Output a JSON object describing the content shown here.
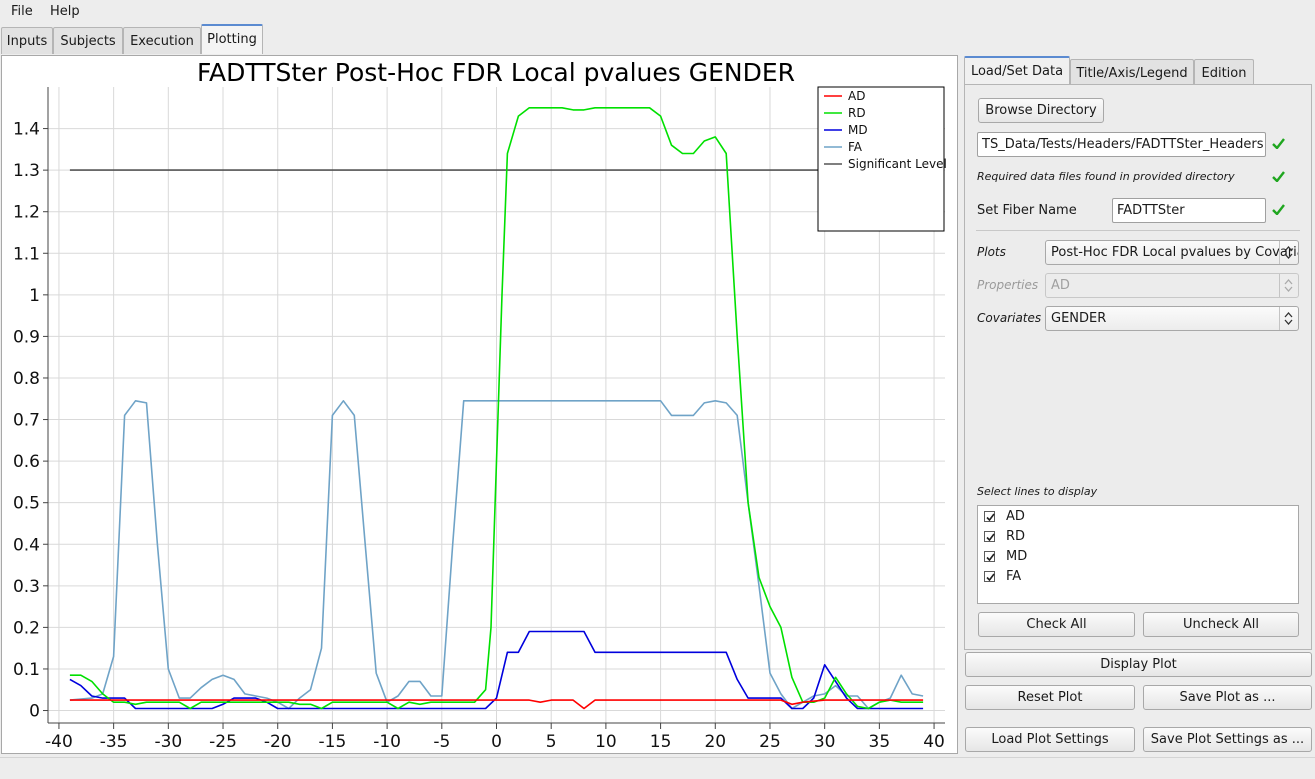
{
  "menu": {
    "file": "File",
    "help": "Help"
  },
  "main_tabs": [
    "Inputs",
    "Subjects",
    "Execution",
    "Plotting"
  ],
  "right_tabs": [
    "Load/Set Data",
    "Title/Axis/Legend",
    "Edition"
  ],
  "browse_label": "Browse Directory",
  "directory_path": "TS_Data/Tests/Headers/FADTTSter_Headers",
  "data_found_text": "Required data files found in provided directory",
  "fiber_name_label": "Set Fiber Name",
  "fiber_name_value": "FADTTSter",
  "plots_label": "Plots",
  "plots_value": "Post-Hoc FDR Local pvalues by Covariates",
  "properties_label": "Properties",
  "properties_value": "AD",
  "covariates_label": "Covariates",
  "covariates_value": "GENDER",
  "select_lines_label": "Select lines to display",
  "lines": [
    {
      "label": "AD",
      "checked": true
    },
    {
      "label": "RD",
      "checked": true
    },
    {
      "label": "MD",
      "checked": true
    },
    {
      "label": "FA",
      "checked": true
    }
  ],
  "check_all": "Check All",
  "uncheck_all": "Uncheck All",
  "display_plot": "Display Plot",
  "reset_plot": "Reset Plot",
  "save_plot_as": "Save Plot as ...",
  "load_plot_settings": "Load Plot Settings",
  "save_plot_settings_as": "Save Plot Settings as ...",
  "chart_data": {
    "type": "line",
    "title": "FADTTSter Post-Hoc FDR Local pvalues GENDER",
    "xlabel": "",
    "ylabel": "",
    "xlim": [
      -41,
      41
    ],
    "ylim": [
      -0.03,
      1.5
    ],
    "xticks": [
      -40,
      -35,
      -30,
      -25,
      -20,
      -15,
      -10,
      -5,
      0,
      5,
      10,
      15,
      20,
      25,
      30,
      35,
      40
    ],
    "yticks": [
      0,
      0.1,
      0.2,
      0.3,
      0.4,
      0.5,
      0.6,
      0.7,
      0.8,
      0.9,
      1,
      1.1,
      1.2,
      1.3,
      1.4
    ],
    "ytick_labels": [
      "0",
      "0.1",
      "0.2",
      "0.3",
      "0.4",
      "0.5",
      "0.6",
      "0.7",
      "0.8",
      "0.9",
      "1",
      "1.1",
      "1.2",
      "1.3",
      "1.4"
    ],
    "grid": true,
    "legend_position": "top-right",
    "series": [
      {
        "name": "AD",
        "color": "#ff0000",
        "points": [
          [
            -39,
            0.025
          ],
          [
            -30,
            0.025
          ],
          [
            -20,
            0.025
          ],
          [
            -10,
            0.025
          ],
          [
            0,
            0.025
          ],
          [
            3,
            0.025
          ],
          [
            4,
            0.02
          ],
          [
            5,
            0.025
          ],
          [
            7,
            0.025
          ],
          [
            8,
            0.005
          ],
          [
            9,
            0.025
          ],
          [
            20,
            0.025
          ],
          [
            26,
            0.025
          ],
          [
            27,
            0.015
          ],
          [
            28,
            0.02
          ],
          [
            30,
            0.025
          ],
          [
            35,
            0.025
          ],
          [
            39,
            0.025
          ]
        ]
      },
      {
        "name": "RD",
        "color": "#00e000",
        "points": [
          [
            -39,
            0.085
          ],
          [
            -38,
            0.085
          ],
          [
            -37,
            0.07
          ],
          [
            -36,
            0.04
          ],
          [
            -35,
            0.02
          ],
          [
            -34,
            0.02
          ],
          [
            -33,
            0.015
          ],
          [
            -32,
            0.02
          ],
          [
            -30,
            0.02
          ],
          [
            -29,
            0.02
          ],
          [
            -28,
            0.005
          ],
          [
            -27,
            0.02
          ],
          [
            -20,
            0.02
          ],
          [
            -19,
            0.02
          ],
          [
            -18,
            0.015
          ],
          [
            -17,
            0.015
          ],
          [
            -16,
            0.005
          ],
          [
            -15,
            0.02
          ],
          [
            -10,
            0.02
          ],
          [
            -9,
            0.005
          ],
          [
            -8,
            0.02
          ],
          [
            -7,
            0.015
          ],
          [
            -6,
            0.02
          ],
          [
            -2,
            0.02
          ],
          [
            -1,
            0.05
          ],
          [
            -0.5,
            0.2
          ],
          [
            0,
            0.6
          ],
          [
            0.5,
            1.0
          ],
          [
            1,
            1.34
          ],
          [
            2,
            1.43
          ],
          [
            3,
            1.45
          ],
          [
            5,
            1.45
          ],
          [
            6,
            1.45
          ],
          [
            7,
            1.445
          ],
          [
            8,
            1.445
          ],
          [
            9,
            1.45
          ],
          [
            14,
            1.45
          ],
          [
            15,
            1.43
          ],
          [
            16,
            1.36
          ],
          [
            17,
            1.34
          ],
          [
            18,
            1.34
          ],
          [
            19,
            1.37
          ],
          [
            20,
            1.38
          ],
          [
            21,
            1.34
          ],
          [
            22,
            0.9
          ],
          [
            23,
            0.5
          ],
          [
            24,
            0.32
          ],
          [
            25,
            0.25
          ],
          [
            26,
            0.2
          ],
          [
            27,
            0.08
          ],
          [
            28,
            0.02
          ],
          [
            29,
            0.02
          ],
          [
            30,
            0.03
          ],
          [
            31,
            0.08
          ],
          [
            32,
            0.04
          ],
          [
            33,
            0.01
          ],
          [
            34,
            0.005
          ],
          [
            35,
            0.02
          ],
          [
            36,
            0.025
          ],
          [
            37,
            0.02
          ],
          [
            38,
            0.02
          ],
          [
            39,
            0.02
          ]
        ]
      },
      {
        "name": "MD",
        "color": "#0000dd",
        "points": [
          [
            -39,
            0.075
          ],
          [
            -38,
            0.06
          ],
          [
            -37,
            0.035
          ],
          [
            -36,
            0.03
          ],
          [
            -35,
            0.03
          ],
          [
            -34,
            0.03
          ],
          [
            -33,
            0.005
          ],
          [
            -28,
            0.005
          ],
          [
            -26,
            0.005
          ],
          [
            -25,
            0.015
          ],
          [
            -24,
            0.03
          ],
          [
            -22,
            0.03
          ],
          [
            -21,
            0.02
          ],
          [
            -20,
            0.005
          ],
          [
            -16,
            0.005
          ],
          [
            -10,
            0.005
          ],
          [
            -1,
            0.005
          ],
          [
            0,
            0.03
          ],
          [
            1,
            0.14
          ],
          [
            2,
            0.14
          ],
          [
            3,
            0.19
          ],
          [
            8,
            0.19
          ],
          [
            9,
            0.14
          ],
          [
            21,
            0.14
          ],
          [
            22,
            0.075
          ],
          [
            23,
            0.03
          ],
          [
            26,
            0.03
          ],
          [
            27,
            0.005
          ],
          [
            28,
            0.005
          ],
          [
            29,
            0.03
          ],
          [
            30,
            0.11
          ],
          [
            31,
            0.07
          ],
          [
            32,
            0.03
          ],
          [
            33,
            0.005
          ],
          [
            39,
            0.005
          ]
        ]
      },
      {
        "name": "FA",
        "color": "#6fa3c7",
        "points": [
          [
            -39,
            0.025
          ],
          [
            -37,
            0.03
          ],
          [
            -36,
            0.04
          ],
          [
            -35,
            0.13
          ],
          [
            -34,
            0.71
          ],
          [
            -33,
            0.745
          ],
          [
            -32,
            0.74
          ],
          [
            -31,
            0.4
          ],
          [
            -30,
            0.1
          ],
          [
            -29,
            0.03
          ],
          [
            -28,
            0.03
          ],
          [
            -27,
            0.055
          ],
          [
            -26,
            0.075
          ],
          [
            -25,
            0.085
          ],
          [
            -24,
            0.075
          ],
          [
            -23,
            0.04
          ],
          [
            -22,
            0.035
          ],
          [
            -21,
            0.03
          ],
          [
            -20,
            0.02
          ],
          [
            -19,
            0.005
          ],
          [
            -18,
            0.03
          ],
          [
            -17,
            0.05
          ],
          [
            -16,
            0.15
          ],
          [
            -15,
            0.71
          ],
          [
            -14,
            0.745
          ],
          [
            -13,
            0.71
          ],
          [
            -12,
            0.4
          ],
          [
            -11,
            0.09
          ],
          [
            -10,
            0.02
          ],
          [
            -9,
            0.035
          ],
          [
            -8,
            0.07
          ],
          [
            -7,
            0.07
          ],
          [
            -6,
            0.035
          ],
          [
            -5,
            0.035
          ],
          [
            -4,
            0.4
          ],
          [
            -3,
            0.745
          ],
          [
            14,
            0.745
          ],
          [
            15,
            0.745
          ],
          [
            16,
            0.71
          ],
          [
            17,
            0.71
          ],
          [
            18,
            0.71
          ],
          [
            19,
            0.74
          ],
          [
            20,
            0.745
          ],
          [
            21,
            0.74
          ],
          [
            22,
            0.71
          ],
          [
            23,
            0.5
          ],
          [
            24,
            0.3
          ],
          [
            25,
            0.09
          ],
          [
            26,
            0.04
          ],
          [
            27,
            0.005
          ],
          [
            28,
            0.02
          ],
          [
            29,
            0.035
          ],
          [
            30,
            0.04
          ],
          [
            31,
            0.06
          ],
          [
            32,
            0.035
          ],
          [
            33,
            0.035
          ],
          [
            34,
            0.005
          ],
          [
            35,
            0.02
          ],
          [
            36,
            0.03
          ],
          [
            37,
            0.085
          ],
          [
            38,
            0.04
          ],
          [
            39,
            0.035
          ]
        ]
      },
      {
        "name": "Significant Level",
        "color": "#555555",
        "points": [
          [
            -39,
            1.3
          ],
          [
            39,
            1.3
          ]
        ]
      }
    ]
  }
}
